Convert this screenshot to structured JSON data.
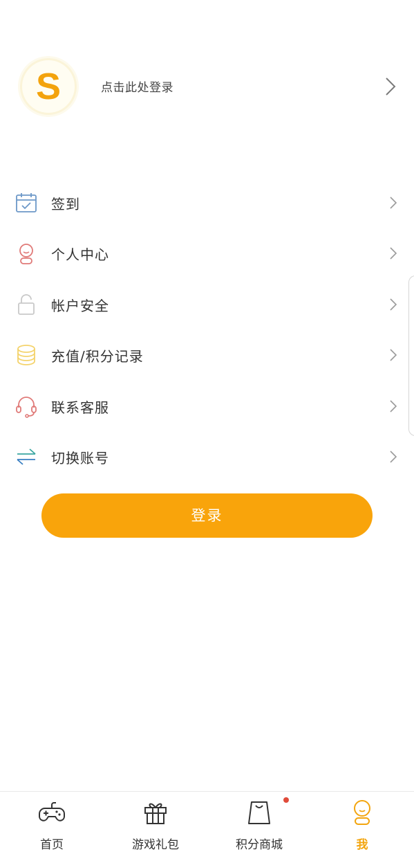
{
  "profile": {
    "avatar_letter": "S",
    "login_hint": "点击此处登录"
  },
  "menu": [
    {
      "label": "签到",
      "icon": "calendar-check-icon",
      "color": "#6c98c8"
    },
    {
      "label": "个人中心",
      "icon": "user-profile-icon",
      "color": "#e07a78"
    },
    {
      "label": "帐户安全",
      "icon": "unlock-icon",
      "color": "#c9c9c9"
    },
    {
      "label": "充值/积分记录",
      "icon": "coin-stack-icon",
      "color": "#f4d36c"
    },
    {
      "label": "联系客服",
      "icon": "headset-icon",
      "color": "#e07a78"
    },
    {
      "label": "切换账号",
      "icon": "switch-arrows-icon",
      "color": "#3aa6a0"
    }
  ],
  "login_button": {
    "label": "登录"
  },
  "tabbar": {
    "items": [
      {
        "label": "首页",
        "icon": "gamepad-icon"
      },
      {
        "label": "游戏礼包",
        "icon": "gift-icon"
      },
      {
        "label": "积分商城",
        "icon": "shopping-bag-icon",
        "has_badge": true
      },
      {
        "label": "我",
        "icon": "user-icon",
        "active": true
      }
    ]
  },
  "colors": {
    "accent": "#f9a40b",
    "active_tab": "#f3a50e",
    "badge": "#e04b3a"
  }
}
